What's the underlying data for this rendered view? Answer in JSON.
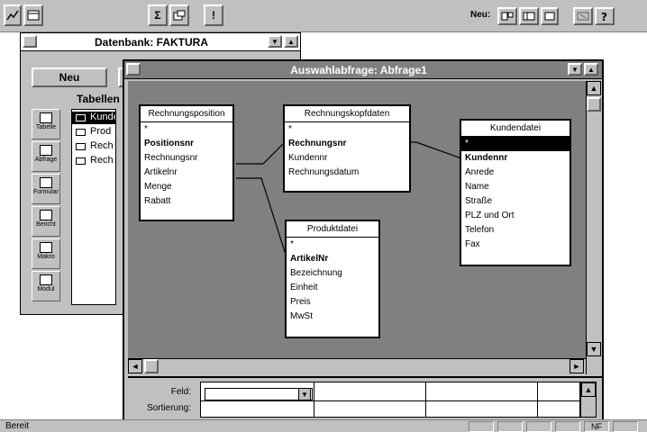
{
  "toolbar": {
    "neu_label": "Neu:",
    "btn_sql": "Σ",
    "btn_run": "!"
  },
  "database_window": {
    "title": "Datenbank: FAKTURA",
    "new_button": "Neu",
    "section_heading": "Tabellen",
    "object_tabs": [
      "Tabelle",
      "Abfrage",
      "Formular",
      "Bericht",
      "Makro",
      "Modul"
    ],
    "tables": [
      {
        "label": "Kunde",
        "selected": true
      },
      {
        "label": "Prod",
        "selected": false
      },
      {
        "label": "Rech",
        "selected": false
      },
      {
        "label": "Rech",
        "selected": false
      }
    ]
  },
  "query_window": {
    "title": "Auswahlabfrage: Abfrage1",
    "field_lists": [
      {
        "title": "Rechnungsposition",
        "fields": [
          {
            "name": "*",
            "pk": false
          },
          {
            "name": "Positionsnr",
            "pk": true
          },
          {
            "name": "Rechnungsnr",
            "pk": false
          },
          {
            "name": "Artikelnr",
            "pk": false
          },
          {
            "name": "Menge",
            "pk": false
          },
          {
            "name": "Rabatt",
            "pk": false
          }
        ]
      },
      {
        "title": "Rechnungskopfdaten",
        "fields": [
          {
            "name": "*",
            "pk": false
          },
          {
            "name": "Rechnungsnr",
            "pk": true
          },
          {
            "name": "Kundennr",
            "pk": false
          },
          {
            "name": "Rechnungsdatum",
            "pk": false
          }
        ]
      },
      {
        "title": "Produktdatei",
        "fields": [
          {
            "name": "*",
            "pk": false
          },
          {
            "name": "ArtikelNr",
            "pk": true
          },
          {
            "name": "Bezeichnung",
            "pk": false
          },
          {
            "name": "Einheit",
            "pk": false
          },
          {
            "name": "Preis",
            "pk": false
          },
          {
            "name": "MwSt",
            "pk": false
          }
        ]
      },
      {
        "title": "Kundendatei",
        "fields": [
          {
            "name": "*",
            "pk": false
          },
          {
            "name": "Kundennr",
            "pk": true
          },
          {
            "name": "Anrede",
            "pk": false
          },
          {
            "name": "Name",
            "pk": false
          },
          {
            "name": "Straße",
            "pk": false
          },
          {
            "name": "PLZ und Ort",
            "pk": false
          },
          {
            "name": "Telefon",
            "pk": false
          },
          {
            "name": "Fax",
            "pk": false
          }
        ]
      }
    ],
    "grid_rows": [
      "Feld:",
      "Sortierung:"
    ]
  },
  "status": {
    "text": "Bereit",
    "indicator": "NF"
  },
  "colors": {
    "window_bg": "#c0c0c0",
    "query_canvas": "#808080",
    "title_active": "#808080",
    "selection": "#000000"
  }
}
